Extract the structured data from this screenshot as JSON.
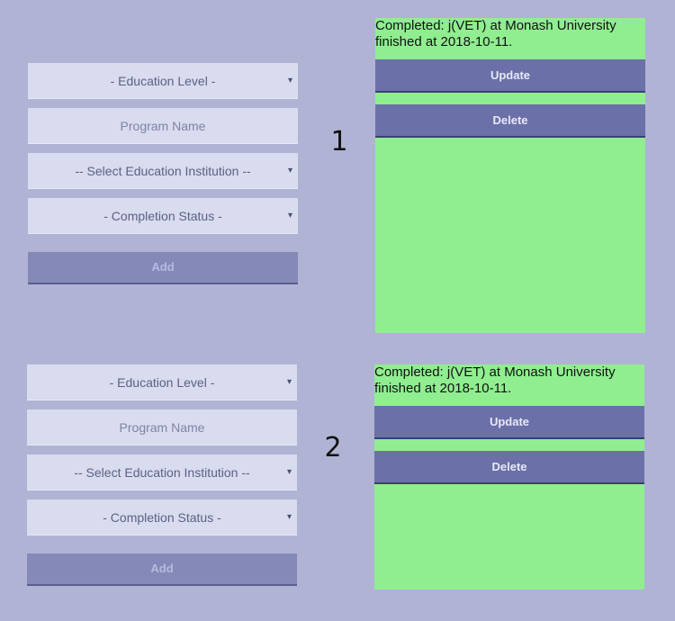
{
  "panels": [
    {
      "label": "1",
      "form": {
        "education_level": "- Education Level -",
        "program_name_placeholder": "Program Name",
        "institution": "-- Select Education Institution --",
        "completion_status": "- Completion Status -",
        "add_label": "Add"
      },
      "card": {
        "line1": "Completed: j(VET) at Monash University",
        "line2": "finished at 2018-10-11.",
        "update_label": "Update",
        "delete_label": "Delete"
      }
    },
    {
      "label": "2",
      "form": {
        "education_level": "- Education Level -",
        "program_name_placeholder": "Program Name",
        "institution": "-- Select Education Institution --",
        "completion_status": "- Completion Status -",
        "add_label": "Add"
      },
      "card": {
        "line1": "Completed: j(VET) at Monash University",
        "line2": "finished at 2018-10-11.",
        "update_label": "Update",
        "delete_label": "Delete"
      }
    }
  ],
  "icons": {
    "dropdown": "chevron-down-icon",
    "dropdown_glyph": "▾"
  },
  "colors": {
    "background": "#b0b3d4",
    "field": "#d9dbee",
    "add_button": "#8489b8",
    "card": "#90ee90",
    "card_button": "#6b70a8"
  }
}
